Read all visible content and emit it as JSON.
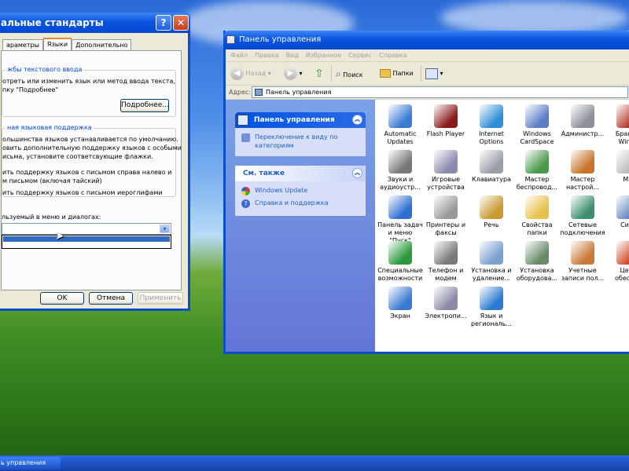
{
  "colors": {
    "xp_blue": "#0054e3",
    "link": "#215dc6",
    "dialog_bg": "#ece9d8"
  },
  "regional_dialog": {
    "title": "альные стандарты",
    "tabs": [
      "араметры",
      "Языки",
      "Дополнительно"
    ],
    "active_tab": "Языки",
    "text_services": {
      "group_title": "жбы текстового ввода",
      "line1": "отреть или изменить язык или метод ввода текста,",
      "line2": "пку \"Подробнее\"",
      "details_button": "Подробнее..."
    },
    "supplemental": {
      "group_title": "ная языковая поддержка",
      "lines": [
        "ольшинства языков устанавливается по умолчанию.",
        "овить дополнительную поддержку языков с особыми",
        "исьма, установите соответсвующие флажки."
      ],
      "checkbox1_line1": "ить поддержку языков с письмом справа налево и",
      "checkbox1_line2": "м письмом (включая тайский)",
      "checkbox2": "ить поддержку языков с письмом иероглифами"
    },
    "menus_label": "льзуемый в меню и диалогах:",
    "buttons": {
      "ok": "OK",
      "cancel": "Отмена",
      "apply": "Применить"
    }
  },
  "control_panel": {
    "title": "Панель управления",
    "menu": [
      "Файл",
      "Правка",
      "Вид",
      "Избранное",
      "Сервис",
      "Справка"
    ],
    "toolbar": {
      "back": "Назад",
      "search": "Поиск",
      "folders": "Папки"
    },
    "address_label": "Адрес:",
    "address_value": "Панель управления",
    "sidebar": {
      "main_title": "Панель управления",
      "switch_link": "Переключение к виду по категориям",
      "see_also_title": "См. также",
      "links": [
        "Windows Update",
        "Справка и поддержка"
      ]
    },
    "items": [
      {
        "label": "Automatic\nUpdates",
        "icon": "automatic-updates-icon",
        "color": "#3a7bd5"
      },
      {
        "label": "Flash Player",
        "icon": "flash-player-icon",
        "color": "#8b1a1a"
      },
      {
        "label": "Internet\nOptions",
        "icon": "internet-options-icon",
        "color": "#2f8fd8"
      },
      {
        "label": "Windows\nCardSpace",
        "icon": "cardspace-icon",
        "color": "#5b7fc7"
      },
      {
        "label": "Администр...",
        "icon": "admin-tools-icon",
        "color": "#8a8f99"
      },
      {
        "label": "Брандм\nWindo",
        "icon": "firewall-icon",
        "color": "#b33a2a"
      },
      {
        "label": "Звуки и\nаудиоустр...",
        "icon": "sound-icon",
        "color": "#777777"
      },
      {
        "label": "Игровые\nустройства",
        "icon": "game-controllers-icon",
        "color": "#8a8ab0"
      },
      {
        "label": "Клавиатура",
        "icon": "keyboard-icon",
        "color": "#9aa0a8"
      },
      {
        "label": "Мастер\nбеспровод...",
        "icon": "wireless-wizard-icon",
        "color": "#4a9a4a"
      },
      {
        "label": "Мастер\nнастрой...",
        "icon": "network-wizard-icon",
        "color": "#c8742a"
      },
      {
        "label": "Мы",
        "icon": "mouse-icon",
        "color": "#bbbbbb"
      },
      {
        "label": "Панель задач\nи меню \"Пуск\"",
        "icon": "taskbar-icon",
        "color": "#2f6ed3"
      },
      {
        "label": "Принтеры и\nфаксы",
        "icon": "printers-icon",
        "color": "#9a9a9a"
      },
      {
        "label": "Речь",
        "icon": "speech-icon",
        "color": "#c89a30"
      },
      {
        "label": "Свойства\nпапки",
        "icon": "folder-options-icon",
        "color": "#e8c24a"
      },
      {
        "label": "Сетевые\nподключения",
        "icon": "network-connections-icon",
        "color": "#3f8f6f"
      },
      {
        "label": "Сист",
        "icon": "system-icon",
        "color": "#6a8ac0"
      },
      {
        "label": "Специальные\nвозможности",
        "icon": "accessibility-icon",
        "color": "#2a9a3a"
      },
      {
        "label": "Телефон и\nмодем",
        "icon": "phone-modem-icon",
        "color": "#7a7a7a"
      },
      {
        "label": "Установка и\nудаление...",
        "icon": "add-remove-icon",
        "color": "#7aa0d0"
      },
      {
        "label": "Установка\nоборудова...",
        "icon": "add-hardware-icon",
        "color": "#6a8a6a"
      },
      {
        "label": "Учетные\nзаписи пол...",
        "icon": "user-accounts-icon",
        "color": "#c87a3a"
      },
      {
        "label": "Цент\nобеспеч",
        "icon": "security-center-icon",
        "color": "#d04a2a"
      },
      {
        "label": "Экран",
        "icon": "display-icon",
        "color": "#3a7ad0"
      },
      {
        "label": "Электропи...",
        "icon": "power-options-icon",
        "color": "#8a8aa8"
      },
      {
        "label": "Язык и\nрегиональ...",
        "icon": "regional-icon",
        "color": "#2a7ad0"
      }
    ]
  },
  "taskbar": {
    "window_button": "ь управления"
  }
}
